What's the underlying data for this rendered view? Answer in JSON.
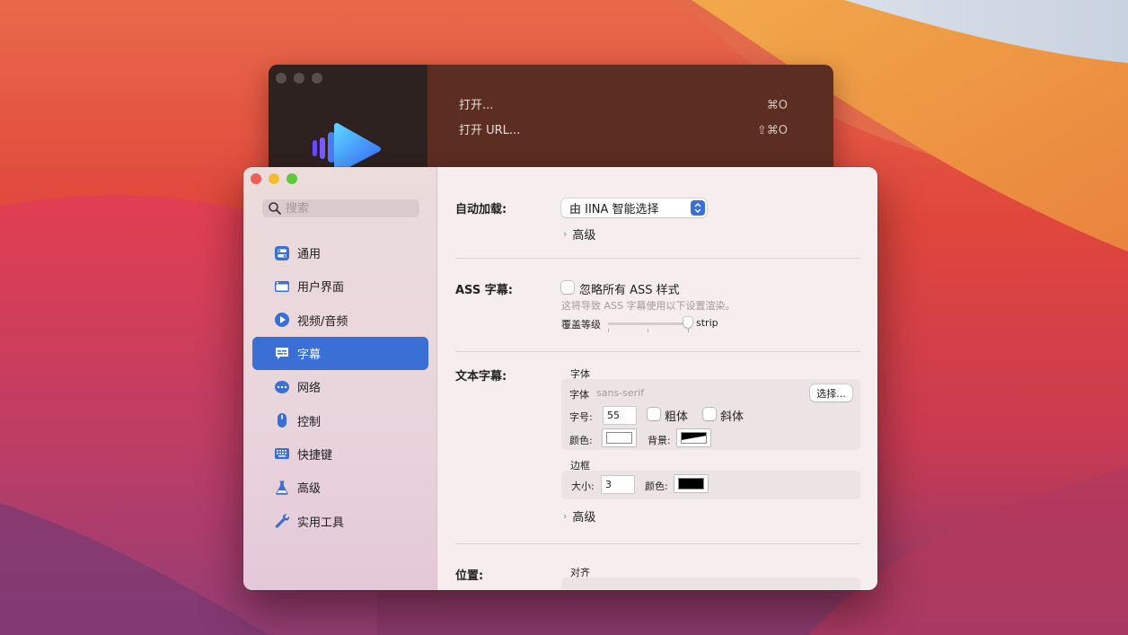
{
  "colors": {
    "accent": "#3a6fd6",
    "window_bg": "#f6eeee"
  },
  "back_window": {
    "menu": [
      {
        "label": "打开...",
        "shortcut": "⌘O"
      },
      {
        "label": "打开 URL...",
        "shortcut": "⇧⌘O"
      }
    ]
  },
  "sidebar": {
    "search_placeholder": "搜索",
    "items": [
      {
        "label": "通用",
        "icon": "toggles-icon"
      },
      {
        "label": "用户界面",
        "icon": "window-icon"
      },
      {
        "label": "视频/音频",
        "icon": "play-circle-icon"
      },
      {
        "label": "字幕",
        "icon": "captions-icon",
        "active": true
      },
      {
        "label": "网络",
        "icon": "network-icon"
      },
      {
        "label": "控制",
        "icon": "mouse-icon"
      },
      {
        "label": "快捷键",
        "icon": "keyboard-icon"
      },
      {
        "label": "高级",
        "icon": "flask-icon"
      },
      {
        "label": "实用工具",
        "icon": "wrench-icon"
      }
    ]
  },
  "content": {
    "autoload": {
      "label": "自动加载:",
      "value": "由 IINA 智能选择",
      "advanced": "高级"
    },
    "ass": {
      "label": "ASS 字幕:",
      "ignore_checkbox": "忽略所有 ASS 样式",
      "ignore_checked": false,
      "note": "这将导致 ASS 字幕使用以下设置渲染。",
      "override_label": "覆盖等级",
      "override_value": "strip",
      "override_level": 1.0
    },
    "text_subs": {
      "label": "文本字幕:",
      "font_section": "字体",
      "font_label": "字体",
      "font_value": "sans-serif",
      "choose_button": "选择...",
      "size_label": "字号:",
      "size_value": "55",
      "bold_label": "粗体",
      "bold_checked": false,
      "italic_label": "斜体",
      "italic_checked": false,
      "color_label": "颜色:",
      "bg_label": "背景:",
      "border_section": "边框",
      "border_size_label": "大小:",
      "border_size_value": "3",
      "border_color_label": "颜色:",
      "advanced": "高级"
    },
    "position": {
      "label": "位置:",
      "align_section": "对齐"
    }
  }
}
